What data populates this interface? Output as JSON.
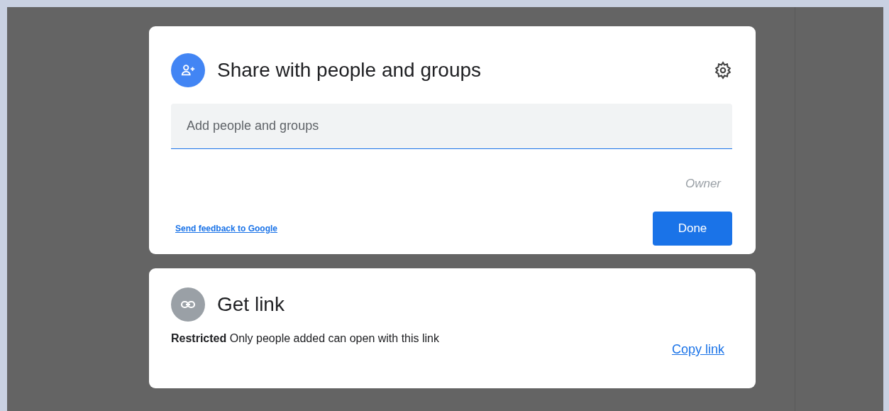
{
  "share_dialog": {
    "title": "Share with people and groups",
    "add_field": {
      "placeholder": "Add people and groups"
    },
    "owner_label": "Owner",
    "feedback_link": "Send feedback to Google",
    "done_button": "Done"
  },
  "link_dialog": {
    "title": "Get link",
    "description": "**Restricted** Only people added can open with this link",
    "copy_link": "Copy link"
  }
}
